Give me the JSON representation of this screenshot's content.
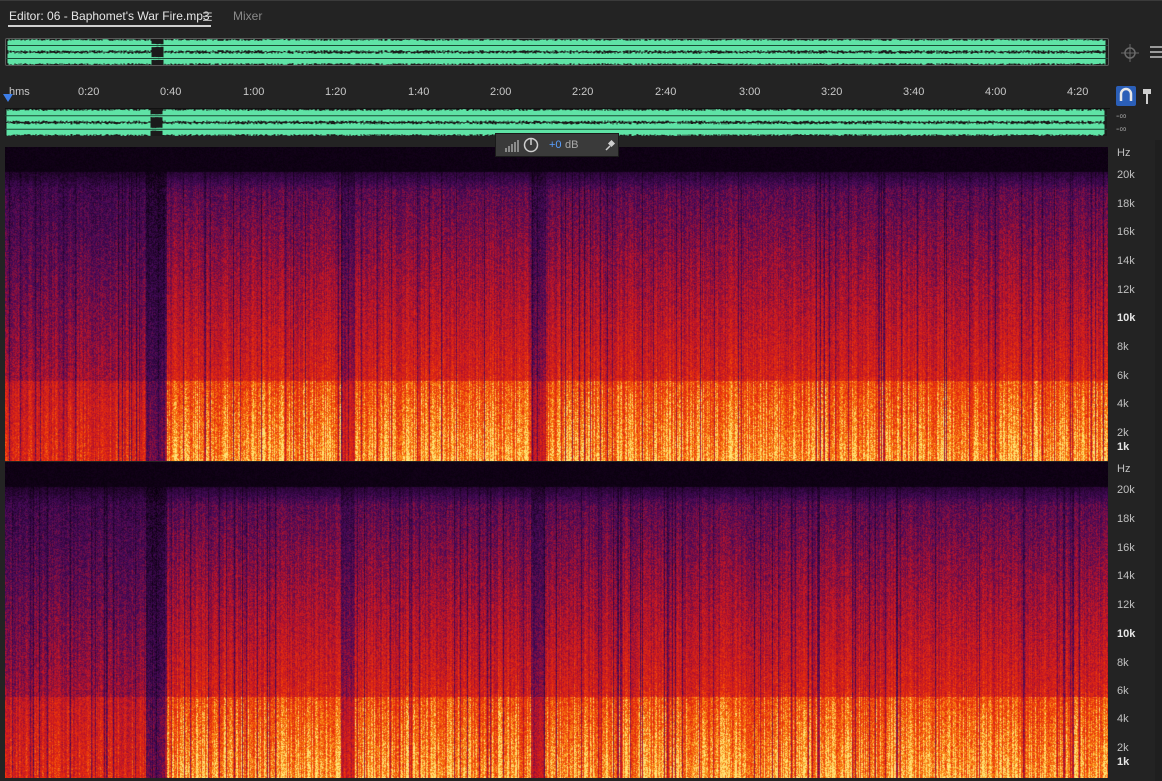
{
  "tabs": {
    "editor_label": "Editor: 06 - Baphomet's War Fire.mp3",
    "mixer_label": "Mixer",
    "menu_icon": "hamburger-icon"
  },
  "ruler": {
    "unit": "hms",
    "ticks": [
      "0:20",
      "0:40",
      "1:00",
      "1:20",
      "1:40",
      "2:00",
      "2:20",
      "2:40",
      "3:00",
      "3:20",
      "3:40",
      "4:00",
      "4:20"
    ]
  },
  "levels": {
    "ch1": "-∞",
    "ch2": "-∞"
  },
  "hud": {
    "gain": "+0",
    "unit": "dB"
  },
  "frequency_axis": {
    "unit": "Hz",
    "labels": [
      "20k",
      "18k",
      "16k",
      "14k",
      "12k",
      "10k",
      "8k",
      "6k",
      "4k",
      "2k",
      "1k"
    ]
  },
  "colors": {
    "waveform": "#5fe3a6",
    "accent": "#3d7ee8",
    "hud_gain": "#5aa0ff"
  }
}
